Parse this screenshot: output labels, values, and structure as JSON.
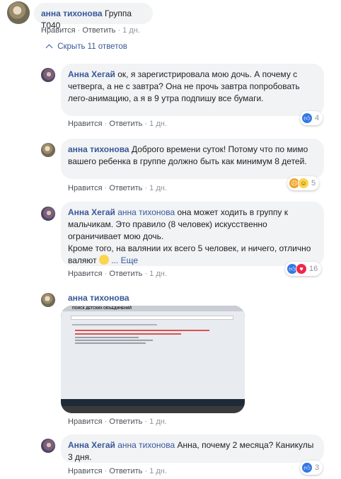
{
  "top_comment": {
    "author": "анна тихонова",
    "text": "Группа Т040",
    "like": "Нравится",
    "reply": "Ответить",
    "time": "1 дн."
  },
  "hide_replies": "Скрыть 11 ответов",
  "replies": [
    {
      "author": "Анна Хегай",
      "text": "ок, я зарегистрировала мою дочь. А почему с четверга, а не с завтра? Она не прочь завтра попробовать лего-анимацию, а я в 9 утра подпишу все бумаги.",
      "like": "Нравится",
      "reply": "Ответить",
      "time": "1 дн.",
      "reaction_count": "4"
    },
    {
      "author": "анна тихонова",
      "text": "Доброго времени суток! Потому что по мимо вашего ребенка в группе должно быть как минимум 8 детей.",
      "like": "Нравится",
      "reply": "Ответить",
      "time": "1 дн.",
      "reaction_count": "5"
    },
    {
      "author": "Анна Хегай",
      "mention": "анна тихонова",
      "text_line1": "она может ходить в группу к мальчикам. Это правило (8 человек) искусственно ограничивает мою дочь.",
      "text_line2": "Кроме того, на валянии их всего 5 человек, и ничего, отлично валяют",
      "more": "... Еще",
      "like": "Нравится",
      "reply": "Ответить",
      "time": "1 дн.",
      "reaction_count": "16"
    },
    {
      "author": "анна тихонова",
      "photo_caption": "ПОИСК ДЕТСКИХ ОБЪЕДИНЕНИЙ",
      "like": "Нравится",
      "reply": "Ответить",
      "time": "1 дн."
    },
    {
      "author": "Анна Хегай",
      "mention": "анна тихонова",
      "text": "Анна, почему 2 месяца? Каникулы 3 дня.",
      "like": "Нравится",
      "reply": "Ответить",
      "time": "1 дн.",
      "reaction_count": "3"
    }
  ],
  "separator": "·",
  "icons": {
    "like": "like-icon",
    "love": "love-icon",
    "angry": "angry-icon",
    "laugh": "laugh-icon",
    "collapse": "chevron-up-icon"
  },
  "colors": {
    "link": "#385898",
    "bubble": "#f2f3f5",
    "like": "#3578e5",
    "love": "#f0284a"
  }
}
